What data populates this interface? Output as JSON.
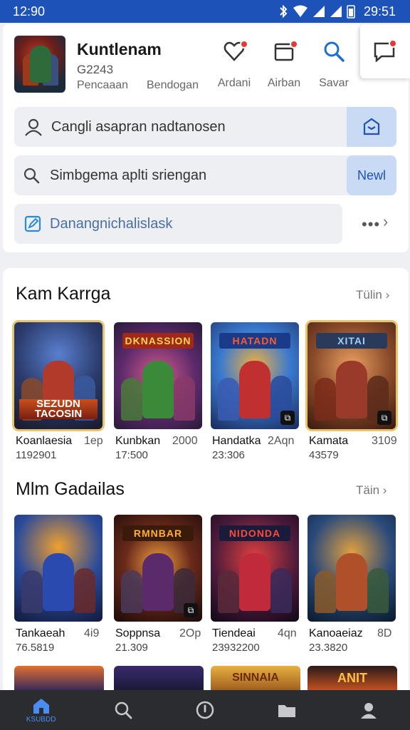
{
  "status": {
    "time": "12:90",
    "clock": "29:51"
  },
  "app": {
    "title": "Kuntlenam",
    "subtitle": "G2243",
    "meta_left": "Pencaaan",
    "meta_right": "Bendogan"
  },
  "header_actions": [
    {
      "label": "Ardani",
      "icon": "heart-badge-icon"
    },
    {
      "label": "Airban",
      "icon": "inbox-icon"
    },
    {
      "label": "Savar",
      "icon": "search-icon"
    }
  ],
  "search": {
    "placeholder": "Cangli asapran nadtanosen"
  },
  "search2": {
    "placeholder": "Simbgema aplti sriengan",
    "button": "Newl"
  },
  "promo": {
    "text": "Danangnichalislask"
  },
  "sections": [
    {
      "title": "Kam Karrga",
      "more": "Tülin",
      "items": [
        {
          "name": "Koanlaesia",
          "meta": "1ep",
          "count": "1192901",
          "banner": "",
          "strip": "SEZUDN TACOSIN"
        },
        {
          "name": "Kunbkan",
          "meta": "2000",
          "count": "17:500",
          "banner": "DKNASSION",
          "strip": ""
        },
        {
          "name": "Handatka",
          "meta": "2Aqn",
          "count": "23:306",
          "banner": "HATADN",
          "strip": ""
        },
        {
          "name": "Kamata",
          "meta": "3109",
          "count": "43579",
          "banner": "XITAI",
          "strip": ""
        }
      ]
    },
    {
      "title": "Mlm Gadailas",
      "more": "Täin",
      "items": [
        {
          "name": "Tankaeah",
          "meta": "4i9",
          "count": "76.5819",
          "banner": "",
          "strip": ""
        },
        {
          "name": "Soppnsa",
          "meta": "2Op",
          "count": "21.309",
          "banner": "RMNBAR",
          "strip": ""
        },
        {
          "name": "Tiendeai",
          "meta": "4qn",
          "count": "23932200",
          "banner": "NIDONDA",
          "strip": ""
        },
        {
          "name": "Kanoaeiaz",
          "meta": "8D",
          "count": "23.3820",
          "banner": "",
          "strip": ""
        }
      ]
    }
  ],
  "peek_banners": [
    "",
    "",
    "SINNAIA",
    "ANIT"
  ],
  "nav": {
    "home_caption": "KSUBDD"
  },
  "colors": {
    "accent": "#1d52b8",
    "badge": "#e53935",
    "nav_bg": "#2b2c30"
  }
}
